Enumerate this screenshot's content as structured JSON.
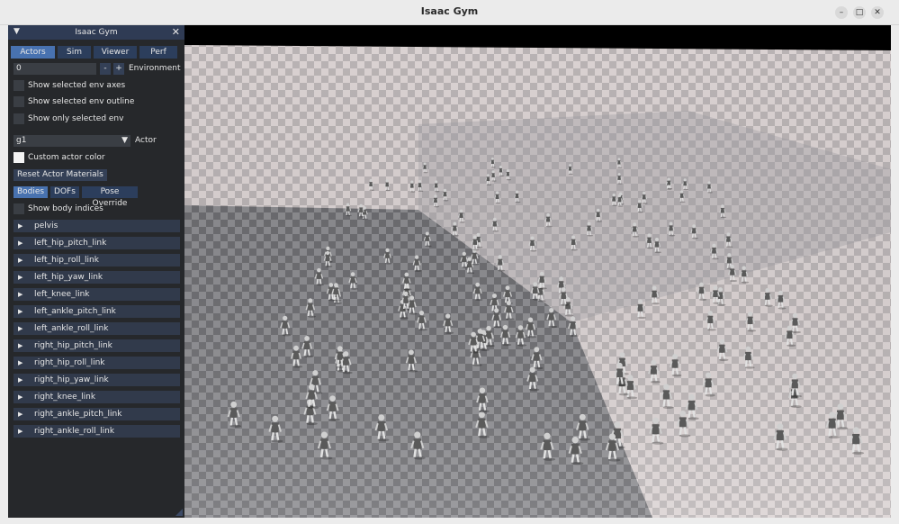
{
  "window": {
    "title": "Isaac Gym",
    "minimize_icon": "minimize-icon",
    "maximize_icon": "maximize-icon",
    "close_icon": "close-icon"
  },
  "panel": {
    "title": "Isaac Gym",
    "collapse_icon": "triangle-down-icon",
    "close_glyph": "✕",
    "tabs": [
      {
        "label": "Actors",
        "active": true
      },
      {
        "label": "Sim",
        "active": false
      },
      {
        "label": "Viewer",
        "active": false
      },
      {
        "label": "Perf",
        "active": false
      }
    ],
    "environment": {
      "value": "0",
      "minus": "-",
      "plus": "+",
      "label": "Environment"
    },
    "env_options": [
      {
        "label": "Show selected env axes",
        "checked": false
      },
      {
        "label": "Show selected env outline",
        "checked": false
      },
      {
        "label": "Show only selected env",
        "checked": false
      }
    ],
    "actor": {
      "value": "g1",
      "label": "Actor"
    },
    "custom_color": {
      "label": "Custom actor color",
      "checked": true
    },
    "reset_button": "Reset Actor Materials",
    "subtabs": [
      {
        "label": "Bodies",
        "active": true
      },
      {
        "label": "DOFs",
        "active": false
      },
      {
        "label": "Pose Override",
        "active": false
      }
    ],
    "show_body_indices": {
      "label": "Show body indices",
      "checked": false
    },
    "bodies": [
      "pelvis",
      "left_hip_pitch_link",
      "left_hip_roll_link",
      "left_hip_yaw_link",
      "left_knee_link",
      "left_ankle_pitch_link",
      "left_ankle_roll_link",
      "right_hip_pitch_link",
      "right_hip_roll_link",
      "right_hip_yaw_link",
      "right_knee_link",
      "right_ankle_pitch_link",
      "right_ankle_roll_link"
    ]
  },
  "colors": {
    "panel_bg": "#26282b",
    "panel_header": "#2f3b54",
    "tab_active": "#4872b0",
    "tab_inactive": "#2c3e5c",
    "tree_row": "#313a4b",
    "floor_light": "#d8cfcf",
    "floor_dark": "#7c7c80"
  }
}
